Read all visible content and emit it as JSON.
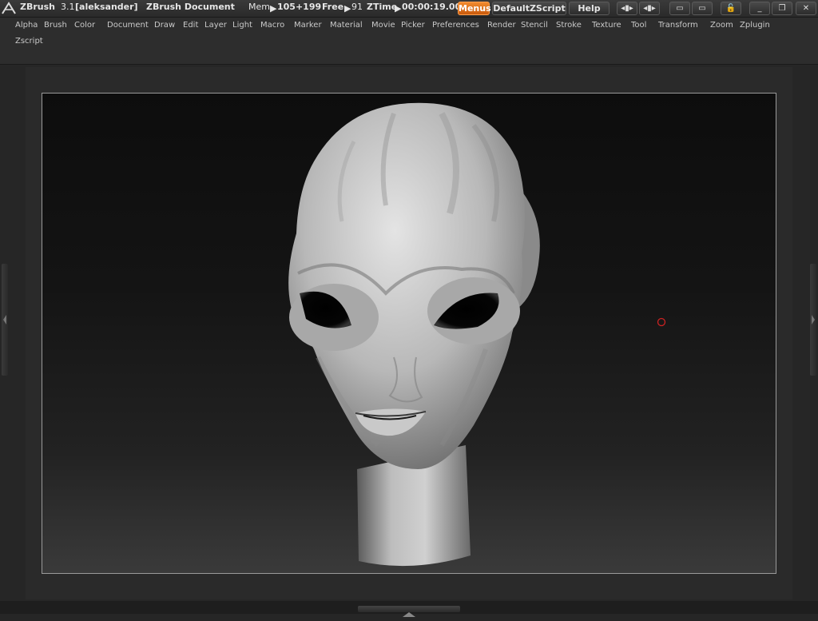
{
  "app": {
    "name": "ZBrush",
    "version": "3.1",
    "user": "[aleksander]",
    "document_label": "ZBrush Document"
  },
  "status": {
    "mem_label": "Mem",
    "mem_value": "105+199",
    "free_label": "Free",
    "free_value": "91",
    "ztime_label": "ZTime",
    "ztime_value": "00:00:19.00"
  },
  "buttons": {
    "menus": "Menus",
    "script": "DefaultZScript",
    "help": "Help"
  },
  "menu": [
    "Alpha",
    "Brush",
    "Color",
    "Document",
    "Draw",
    "Edit",
    "Layer",
    "Light",
    "Macro",
    "Marker",
    "Material",
    "Movie",
    "Picker",
    "Preferences",
    "Render",
    "Stencil",
    "Stroke",
    "Texture",
    "Tool",
    "Transform",
    "Zoom",
    "Zplugin",
    "Zscript"
  ],
  "colors": {
    "accent": "#e8751a",
    "background": "#262626",
    "cursor": "#cc2222"
  },
  "icons": {
    "logo": "zbrush-logo-icon",
    "minimize": "minimize-icon",
    "restore": "restore-icon",
    "close": "close-icon"
  }
}
